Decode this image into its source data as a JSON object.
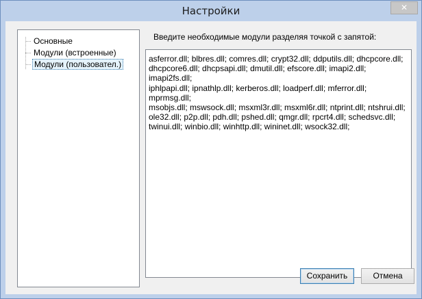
{
  "window": {
    "title": "Настройки",
    "close_glyph": "✕"
  },
  "tree": {
    "items": [
      {
        "label": "Основные",
        "selected": false
      },
      {
        "label": "Модули (встроенные)",
        "selected": false
      },
      {
        "label": "Модули (пользовател.)",
        "selected": true
      }
    ]
  },
  "main": {
    "prompt": "Введите необходимые модули разделяя точкой с запятой:",
    "modules_text": "asferror.dll; blbres.dll; comres.dll; crypt32.dll; ddputils.dll; dhcpcore.dll;\ndhcpcore6.dll; dhcpsapi.dll; dmutil.dll; efscore.dll; imapi2.dll; imapi2fs.dll;\niphlpapi.dll; ipnathlp.dll; kerberos.dll; loadperf.dll; mferror.dll; mprmsg.dll;\nmsobjs.dll; mswsock.dll; msxml3r.dll; msxml6r.dll; ntprint.dll; ntshrui.dll;\nole32.dll; p2p.dll; pdh.dll; pshed.dll; qmgr.dll; rpcrt4.dll; schedsvc.dll;\ntwinui.dll; winbio.dll; winhttp.dll; wininet.dll; wsock32.dll;"
  },
  "buttons": {
    "save_label": "Сохранить",
    "cancel_label": "Отмена"
  },
  "colors": {
    "frame": "#bdd0ea",
    "client": "#f0f0f0",
    "close_button": "#c7c7c7",
    "selection": "#e5f3fb"
  }
}
